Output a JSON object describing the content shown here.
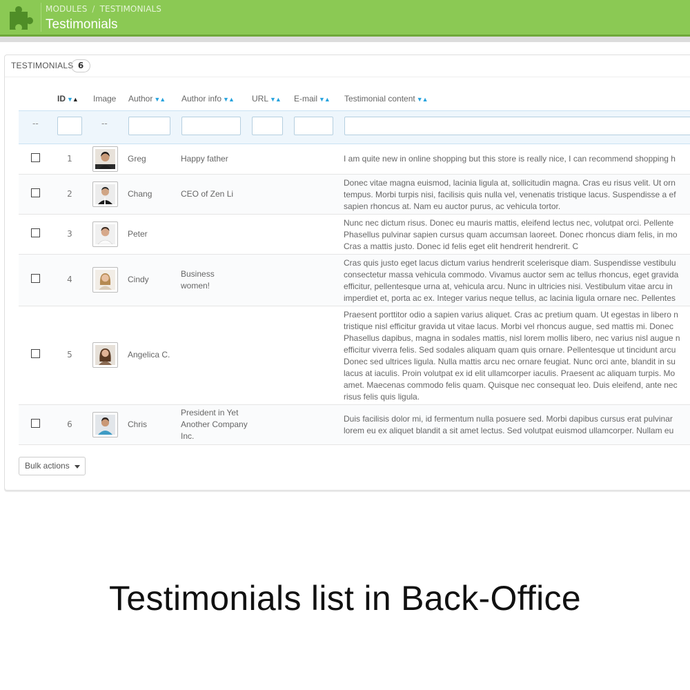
{
  "header": {
    "breadcrumb": [
      "MODULES",
      "TESTIMONIALS"
    ],
    "breadcrumb_separator": "/",
    "title": "Testimonials",
    "accent_color": "#8bc954",
    "icon": "puzzle-icon"
  },
  "panel": {
    "title": "TESTIMONIALS",
    "count": "6"
  },
  "table": {
    "columns": [
      "ID",
      "Image",
      "Author",
      "Author info",
      "URL",
      "E-mail",
      "Testimonial content"
    ],
    "filter_placeholder": "--",
    "rows": [
      {
        "id": "1",
        "author": "Greg",
        "author_info": "Happy father",
        "content": [
          "I am quite new in online shopping but this store is really nice, I can recommend shopping h"
        ]
      },
      {
        "id": "2",
        "author": "Chang",
        "author_info": "CEO of Zen Li",
        "content": [
          "Donec vitae magna euismod, lacinia ligula at, sollicitudin magna. Cras eu risus velit. Ut orn",
          "tempus. Morbi turpis nisi, facilisis quis nulla vel, venenatis tristique lacus. Suspendisse a ef",
          "sapien rhoncus at. Nam eu auctor purus, ac vehicula tortor."
        ]
      },
      {
        "id": "3",
        "author": "Peter",
        "author_info": "",
        "content": [
          "Nunc nec dictum risus. Donec eu mauris mattis, eleifend lectus nec, volutpat orci. Pellente",
          "Phasellus pulvinar sapien cursus quam accumsan laoreet. Donec rhoncus diam felis, in mo",
          "Cras a mattis justo. Donec id felis eget elit hendrerit hendrerit. C"
        ]
      },
      {
        "id": "4",
        "author": "Cindy",
        "author_info": "Business women!",
        "content": [
          "Cras quis justo eget lacus dictum varius hendrerit scelerisque diam. Suspendisse vestibulu",
          "consectetur massa vehicula commodo. Vivamus auctor sem ac tellus rhoncus, eget gravida",
          "efficitur, pellentesque urna at, vehicula arcu. Nunc in ultricies nisi. Vestibulum vitae arcu in",
          "imperdiet et, porta ac ex. Integer varius neque tellus, ac lacinia ligula ornare nec. Pellentes"
        ]
      },
      {
        "id": "5",
        "author": "Angelica C.",
        "author_info": "",
        "content": [
          "Praesent porttitor odio a sapien varius aliquet. Cras ac pretium quam. Ut egestas in libero n",
          "tristique nisl efficitur gravida ut vitae lacus. Morbi vel rhoncus augue, sed mattis mi. Donec",
          "Phasellus dapibus, magna in sodales mattis, nisl lorem mollis libero, nec varius nisl augue n",
          "efficitur viverra felis. Sed sodales aliquam quam quis ornare. Pellentesque ut tincidunt arcu",
          "Donec sed ultrices ligula. Nulla mattis arcu nec ornare feugiat. Nunc orci ante, blandit in su",
          "lacus at iaculis. Proin volutpat ex id elit ullamcorper iaculis. Praesent ac aliquam turpis. Mo",
          "amet. Maecenas commodo felis quam. Quisque nec consequat leo. Duis eleifend, ante nec",
          "risus felis quis ligula."
        ]
      },
      {
        "id": "6",
        "author": "Chris",
        "author_info": "President in Yet Another Company Inc.",
        "content": [
          "Duis facilisis dolor mi, id fermentum nulla posuere sed. Morbi dapibus cursus erat pulvinar",
          "lorem eu ex aliquet blandit a sit amet lectus. Sed volutpat euismod ullamcorper. Nullam eu"
        ]
      }
    ]
  },
  "bulk_actions_label": "Bulk actions",
  "caption": "Testimonials list in Back-Office"
}
